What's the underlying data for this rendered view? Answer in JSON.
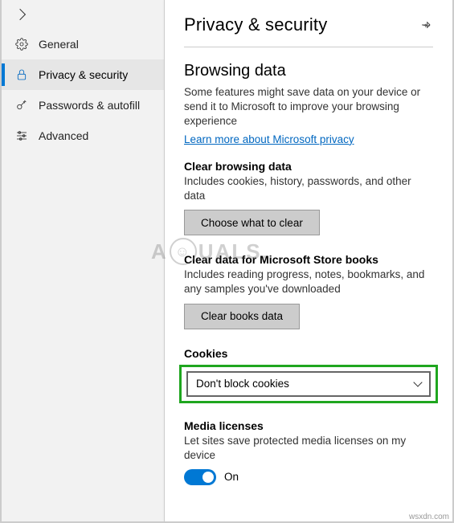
{
  "sidebar": {
    "items": [
      {
        "label": "General",
        "icon": "gear-icon"
      },
      {
        "label": "Privacy & security",
        "icon": "lock-icon"
      },
      {
        "label": "Passwords & autofill",
        "icon": "key-icon"
      },
      {
        "label": "Advanced",
        "icon": "sliders-icon"
      }
    ]
  },
  "header": {
    "title": "Privacy & security"
  },
  "browsing": {
    "title": "Browsing data",
    "desc": "Some features might save data on your device or send it to Microsoft to improve your browsing experience",
    "link": "Learn more about Microsoft privacy"
  },
  "clear": {
    "title": "Clear browsing data",
    "desc": "Includes cookies, history, passwords, and other data",
    "button": "Choose what to clear"
  },
  "books": {
    "title": "Clear data for Microsoft Store books",
    "desc": "Includes reading progress, notes, bookmarks, and any samples you've downloaded",
    "button": "Clear books data"
  },
  "cookies": {
    "title": "Cookies",
    "selected": "Don't block cookies"
  },
  "media": {
    "title": "Media licenses",
    "desc": "Let sites save protected media licenses on my device",
    "toggle_label": "On"
  },
  "attribution": "wsxdn.com",
  "watermark": {
    "pre": "A",
    "post": "UALS."
  }
}
